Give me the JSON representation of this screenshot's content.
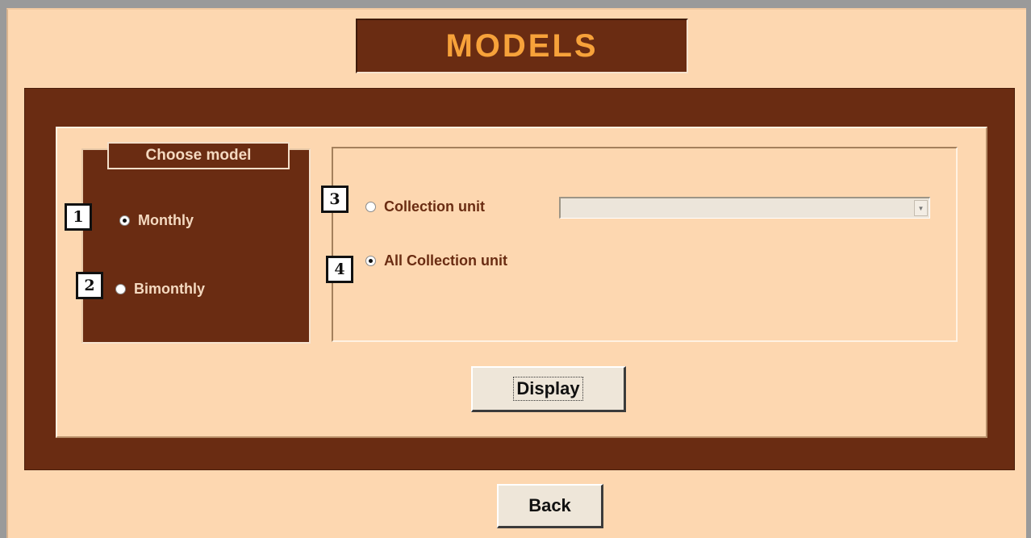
{
  "window": {
    "title": "MODELS"
  },
  "model_group": {
    "legend": "Choose model",
    "options": [
      {
        "badge": "1",
        "label": "Monthly",
        "selected": true
      },
      {
        "badge": "2",
        "label": "Bimonthly",
        "selected": false
      }
    ]
  },
  "scope_group": {
    "options": [
      {
        "badge": "3",
        "label": "Collection unit",
        "selected": false
      },
      {
        "badge": "4",
        "label": "All Collection unit",
        "selected": true
      }
    ],
    "collection_unit_select": {
      "value": "",
      "icon": "dropdown-arrow-icon"
    }
  },
  "buttons": {
    "display_label": "Display",
    "back_label": "Back"
  },
  "colors": {
    "background": "#fdd7b0",
    "frame": "#6a2c12",
    "title_text": "#f7a23a",
    "light_text": "#f4d9c0"
  }
}
